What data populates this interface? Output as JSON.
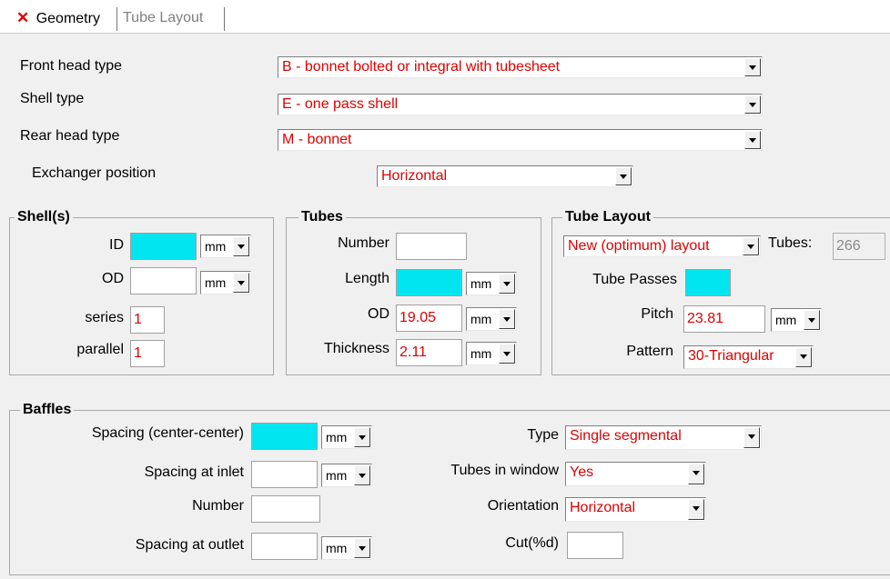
{
  "tabs": [
    {
      "label": "Geometry",
      "active": true,
      "icon": "x-icon"
    },
    {
      "label": "Tube Layout",
      "active": false
    }
  ],
  "header": {
    "front_head_label": "Front head type",
    "front_head_value": "B - bonnet bolted or integral with tubesheet",
    "shell_type_label": "Shell type",
    "shell_type_value": "E - one pass shell",
    "rear_head_label": "Rear head type",
    "rear_head_value": "M - bonnet",
    "position_label": "Exchanger position",
    "position_value": "Horizontal"
  },
  "shell": {
    "title": "Shell(s)",
    "id_label": "ID",
    "id_value": "",
    "id_unit": "mm",
    "od_label": "OD",
    "od_value": "",
    "od_unit": "mm",
    "series_label": "series",
    "series_value": "1",
    "parallel_label": "parallel",
    "parallel_value": "1"
  },
  "tubes": {
    "title": "Tubes",
    "number_label": "Number",
    "number_value": "",
    "length_label": "Length",
    "length_value": "",
    "length_unit": "mm",
    "od_label": "OD",
    "od_value": "19.05",
    "od_unit": "mm",
    "thickness_label": "Thickness",
    "thickness_value": "2.11",
    "thickness_unit": "mm"
  },
  "layout": {
    "title": "Tube Layout",
    "layout_value": "New (optimum) layout",
    "tubes_label": "Tubes:",
    "tubes_value": "266",
    "passes_label": "Tube Passes",
    "passes_value": "",
    "pitch_label": "Pitch",
    "pitch_value": "23.81",
    "pitch_unit": "mm",
    "pattern_label": "Pattern",
    "pattern_value": "30-Triangular"
  },
  "baffles": {
    "title": "Baffles",
    "spacing_cc_label": "Spacing (center-center)",
    "spacing_cc_value": "",
    "spacing_cc_unit": "mm",
    "spacing_inlet_label": "Spacing at inlet",
    "spacing_inlet_value": "",
    "spacing_inlet_unit": "mm",
    "number_label": "Number",
    "number_value": "",
    "spacing_outlet_label": "Spacing at outlet",
    "spacing_outlet_value": "",
    "spacing_outlet_unit": "mm",
    "type_label": "Type",
    "type_value": "Single segmental",
    "tubes_window_label": "Tubes in window",
    "tubes_window_value": "Yes",
    "orientation_label": "Orientation",
    "orientation_value": "Horizontal",
    "cut_label": "Cut(%d)",
    "cut_value": ""
  },
  "colors": {
    "value_text": "#e00000",
    "required_field": "#00e5f0",
    "panel_bg": "#f0f0f0",
    "close_icon": "#e00000"
  }
}
